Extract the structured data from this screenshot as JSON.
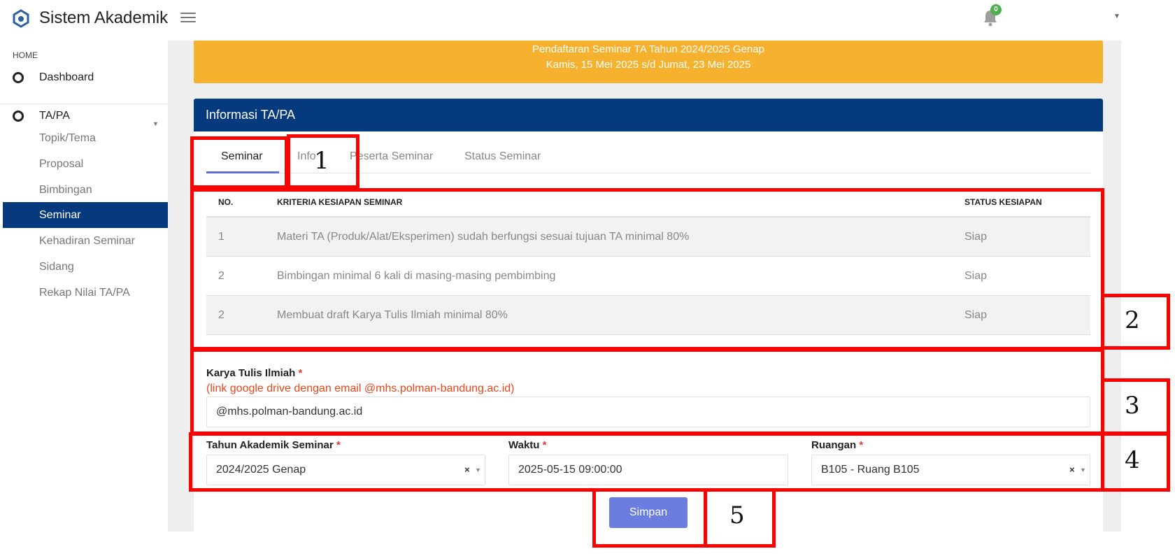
{
  "app": {
    "title": "Sistem Akademik",
    "notification_count": "0"
  },
  "sidebar": {
    "section": "HOME",
    "dashboard": "Dashboard",
    "group": "TA/PA",
    "items": [
      {
        "label": "Topik/Tema"
      },
      {
        "label": "Proposal"
      },
      {
        "label": "Bimbingan"
      },
      {
        "label": "Seminar",
        "active": true
      },
      {
        "label": "Kehadiran Seminar"
      },
      {
        "label": "Sidang"
      },
      {
        "label": "Rekap Nilai TA/PA"
      }
    ]
  },
  "banner": {
    "line1": "Pendaftaran Seminar TA Tahun 2024/2025 Genap",
    "line2": "Kamis, 15 Mei 2025 s/d Jumat, 23 Mei 2025"
  },
  "card": {
    "title": "Informasi TA/PA",
    "tabs": [
      "Seminar",
      "Info",
      "Peserta Seminar",
      "Status Seminar"
    ]
  },
  "table": {
    "headers": {
      "no": "NO.",
      "criteria": "KRITERIA KESIAPAN SEMINAR",
      "status": "STATUS KESIAPAN"
    },
    "rows": [
      {
        "no": "1",
        "criteria": "Materi TA (Produk/Alat/Eksperimen) sudah berfungsi sesuai tujuan TA minimal 80%",
        "status": "Siap"
      },
      {
        "no": "2",
        "criteria": "Bimbingan minimal 6 kali di masing-masing pembimbing",
        "status": "Siap"
      },
      {
        "no": "2",
        "criteria": "Membuat draft Karya Tulis Ilmiah minimal 80%",
        "status": "Siap"
      }
    ]
  },
  "form": {
    "kti_label": "Karya Tulis Ilmiah",
    "kti_hint": "(link google drive dengan email @mhs.polman-bandung.ac.id)",
    "kti_value": "@mhs.polman-bandung.ac.id",
    "tahun_label": "Tahun Akademik Seminar",
    "tahun_value": "2024/2025 Genap",
    "waktu_label": "Waktu",
    "waktu_value": "2025-05-15 09:00:00",
    "ruangan_label": "Ruangan",
    "ruangan_value": "B105 - Ruang B105",
    "required_mark": "*",
    "clear_symbol": "×",
    "save_label": "Simpan"
  },
  "annotations": [
    "1",
    "2",
    "3",
    "4",
    "5"
  ],
  "colors": {
    "accent_dark_blue": "#053a7f",
    "banner_orange": "#f6b12f",
    "button_blue": "#6b7ee0",
    "annotation_red": "#ff0000"
  }
}
